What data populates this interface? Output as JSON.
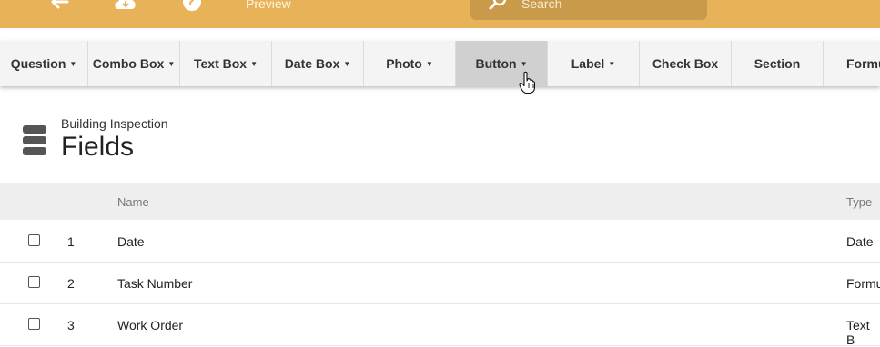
{
  "topbar": {
    "preview_label": "Preview",
    "search_placeholder": "Search",
    "back_icon": "arrow-left-icon",
    "download_icon": "cloud-download-icon",
    "help_icon": "question-circle-icon",
    "search_icon": "search-icon",
    "color": "#e8b358"
  },
  "toolbar": {
    "items": [
      {
        "label": "Question"
      },
      {
        "label": "Combo Box"
      },
      {
        "label": "Text Box"
      },
      {
        "label": "Date Box"
      },
      {
        "label": "Photo"
      },
      {
        "label": "Button"
      },
      {
        "label": "Label"
      },
      {
        "label": "Check Box"
      },
      {
        "label": "Section"
      },
      {
        "label": "Formu"
      }
    ],
    "active_item": "Button"
  },
  "page": {
    "subtitle": "Building Inspection",
    "title": "Fields",
    "icon": "database-icon"
  },
  "table": {
    "headers": {
      "name": "Name",
      "type": "Type"
    },
    "rows": [
      {
        "num": "1",
        "name": "Date",
        "type": "Date"
      },
      {
        "num": "2",
        "name": "Task Number",
        "type": "Formu"
      },
      {
        "num": "3",
        "name": "Work Order",
        "type": "Text B"
      }
    ]
  }
}
